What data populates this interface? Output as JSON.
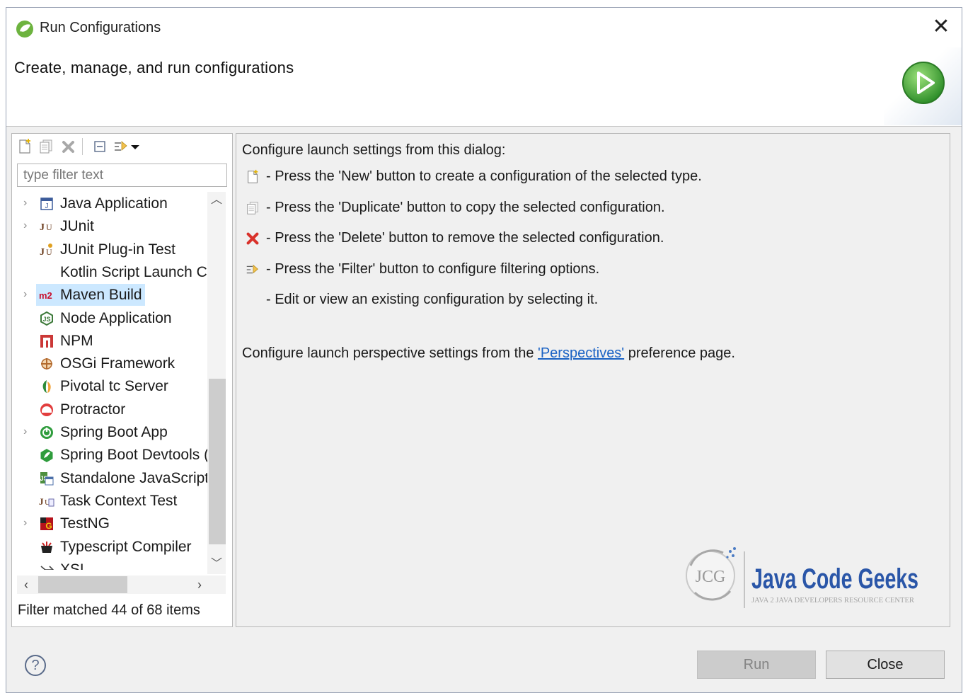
{
  "window": {
    "title": "Run Configurations",
    "close_glyph": "✕"
  },
  "banner": {
    "text": "Create, manage, and run configurations"
  },
  "left": {
    "filter_placeholder": "type filter text",
    "status": "Filter matched 44 of 68 items",
    "tree": [
      {
        "label": "Java Application",
        "expandable": true,
        "icon": "java-app-icon"
      },
      {
        "label": "JUnit",
        "expandable": true,
        "icon": "junit-icon"
      },
      {
        "label": "JUnit Plug-in Test",
        "expandable": false,
        "icon": "junit-plugin-icon"
      },
      {
        "label": "Kotlin Script Launch Co",
        "expandable": false,
        "icon": "none"
      },
      {
        "label": "Maven Build",
        "expandable": true,
        "icon": "maven-icon",
        "selected": true
      },
      {
        "label": "Node Application",
        "expandable": false,
        "icon": "node-icon"
      },
      {
        "label": "NPM",
        "expandable": false,
        "icon": "npm-icon"
      },
      {
        "label": "OSGi Framework",
        "expandable": false,
        "icon": "osgi-icon"
      },
      {
        "label": "Pivotal tc Server",
        "expandable": false,
        "icon": "pivotal-icon"
      },
      {
        "label": "Protractor",
        "expandable": false,
        "icon": "protractor-icon"
      },
      {
        "label": "Spring Boot App",
        "expandable": true,
        "icon": "spring-boot-icon"
      },
      {
        "label": "Spring Boot Devtools (",
        "expandable": false,
        "icon": "spring-devtools-icon"
      },
      {
        "label": "Standalone JavaScript",
        "expandable": false,
        "icon": "standalone-js-icon"
      },
      {
        "label": "Task Context Test",
        "expandable": false,
        "icon": "task-context-icon"
      },
      {
        "label": "TestNG",
        "expandable": true,
        "icon": "testng-icon"
      },
      {
        "label": "Typescript Compiler",
        "expandable": false,
        "icon": "typescript-icon"
      },
      {
        "label": "XSL",
        "expandable": false,
        "icon": "xsl-icon"
      }
    ]
  },
  "right": {
    "heading": "Configure launch settings from this dialog:",
    "rows": [
      "- Press the 'New' button to create a configuration of the selected type.",
      "- Press the 'Duplicate' button to copy the selected configuration.",
      "- Press the 'Delete' button to remove the selected configuration.",
      "- Press the 'Filter' button to configure filtering options.",
      "- Edit or view an existing configuration by selecting it."
    ],
    "persp_before": "Configure launch perspective settings from the ",
    "persp_link": "'Perspectives'",
    "persp_after": " preference page.",
    "logo": {
      "initials": "JCG",
      "name": "Java Code Geeks",
      "tagline": "JAVA 2 JAVA DEVELOPERS RESOURCE CENTER"
    }
  },
  "footer": {
    "help": "?",
    "run_label": "Run",
    "close_label": "Close"
  },
  "colors": {
    "selection": "#cce8ff",
    "link": "#1a62c4",
    "spring_green": "#6db33f",
    "delete_red": "#d9322b"
  }
}
